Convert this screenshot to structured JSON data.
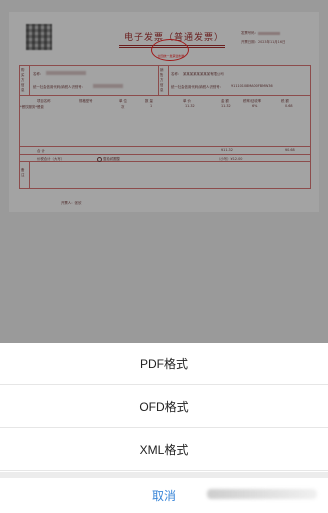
{
  "invoice": {
    "title": "电子发票（普通发票）",
    "stamp_text": "全国统一发票监制章",
    "meta": [
      {
        "label": "发票号码："
      },
      {
        "label": "开票日期：",
        "value": "2023年11月16日"
      }
    ],
    "buyer_name_label": "名称：",
    "buyer_tax_label": "统一社会信用代码/纳税人识别号：",
    "seller_name_label": "名称：",
    "seller_name_value": "某某某某某某某某有限公司",
    "seller_tax_label": "统一社会信用代码/纳税人识别号：",
    "seller_tax_value": "91110108MA00FBMW36",
    "side_buyer": "购买方信息",
    "side_seller": "销售方信息",
    "side_remark": "备注",
    "headers": [
      "项目名称",
      "规格型号",
      "单 位",
      "数 量",
      "单 价",
      "金 额",
      "税率/征收率",
      "税 额"
    ],
    "row": [
      "*餐饮服务*餐费",
      "",
      "次",
      "1",
      "11.32",
      "11.32",
      "6%",
      "0.68"
    ],
    "total_label": "合 计",
    "total_amount": "¥11.32",
    "total_tax": "¥0.68",
    "sum_label": "价税合计（大写）",
    "sum_words": "壹拾贰圆整",
    "sum_small": "（小写）¥12.00",
    "issuer": "开票人：张欣"
  },
  "sheet": {
    "items": [
      "PDF格式",
      "OFD格式",
      "XML格式"
    ],
    "cancel": "取消"
  }
}
